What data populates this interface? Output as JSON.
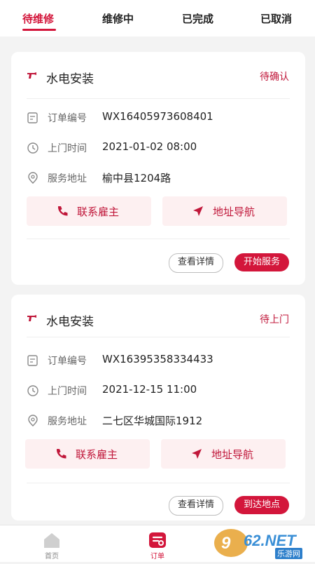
{
  "tabs": [
    {
      "label": "待维修",
      "active": true
    },
    {
      "label": "维修中",
      "active": false
    },
    {
      "label": "已完成",
      "active": false
    },
    {
      "label": "已取消",
      "active": false
    }
  ],
  "orders": [
    {
      "service": "水电安装",
      "status": "待确认",
      "order_no_label": "订单编号",
      "order_no": "WX16405973608401",
      "time_label": "上门时间",
      "time": "2021-01-02 08:00",
      "address_label": "服务地址",
      "address": "榆中县1204路",
      "contact_label": "联系雇主",
      "nav_label": "地址导航",
      "detail_label": "查看详情",
      "primary_label": "开始服务"
    },
    {
      "service": "水电安装",
      "status": "待上门",
      "order_no_label": "订单编号",
      "order_no": "WX16395358334433",
      "time_label": "上门时间",
      "time": "2021-12-15 11:00",
      "address_label": "服务地址",
      "address": "二七区华城国际1912",
      "contact_label": "联系雇主",
      "nav_label": "地址导航",
      "detail_label": "查看详情",
      "primary_label": "到达地点"
    }
  ],
  "bottom_nav": [
    {
      "label": "首页",
      "icon": "home-icon",
      "active": false
    },
    {
      "label": "订单",
      "icon": "order-icon",
      "active": true
    }
  ],
  "watermark": {
    "brand": "962.NET",
    "name": "乐游网"
  },
  "colors": {
    "accent": "#d3163b",
    "button_bg": "#fdf0f1",
    "page_bg": "#f3f3f3"
  }
}
